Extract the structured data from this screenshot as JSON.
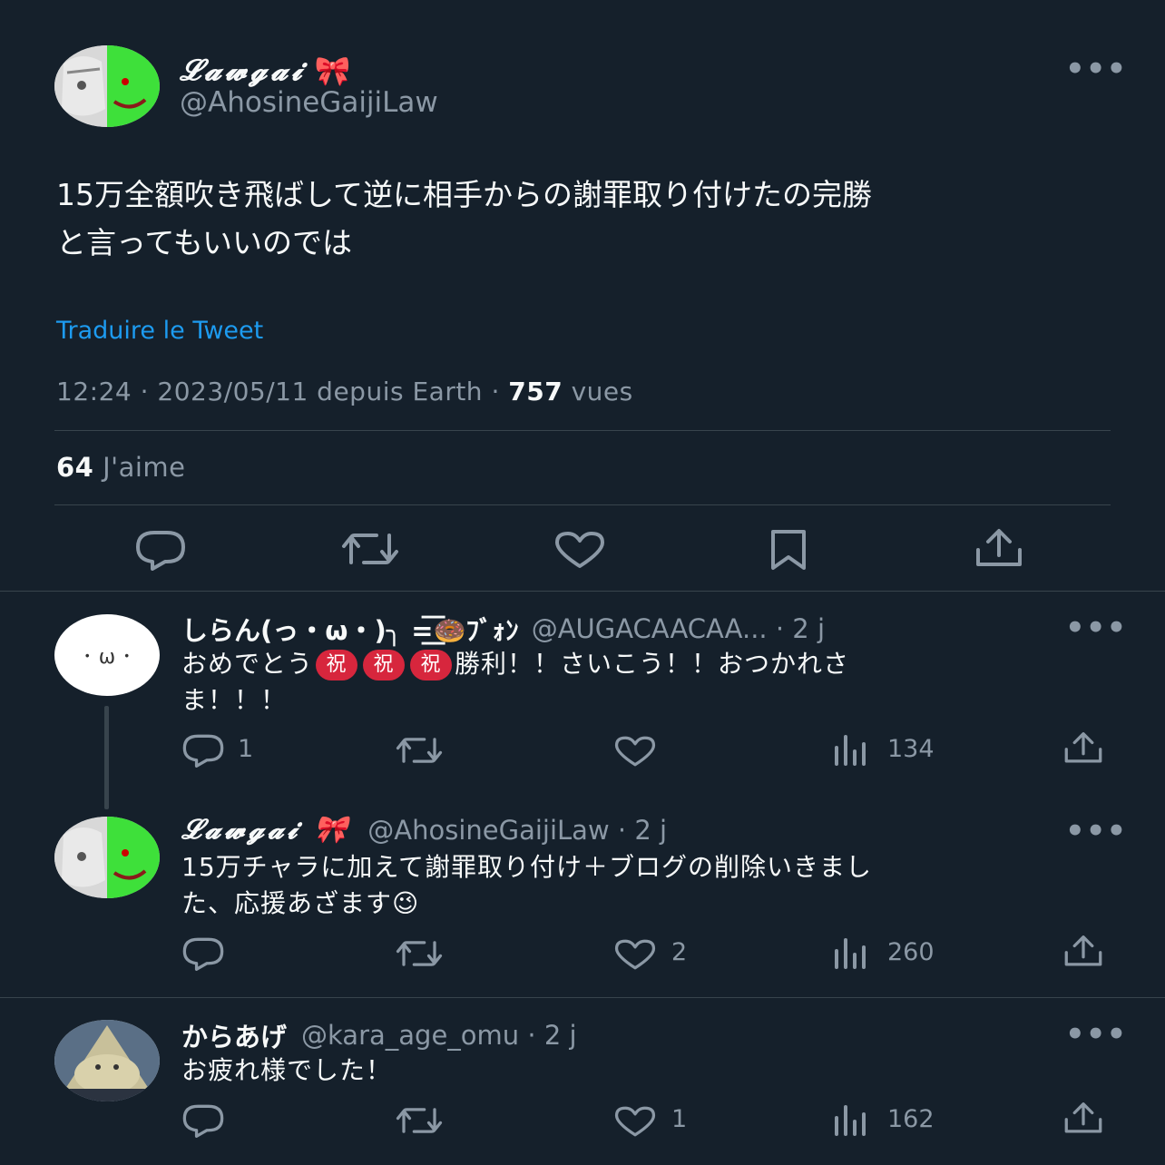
{
  "main_tweet": {
    "author_name": "𝓛𝓪𝔀𝓰𝓪𝓲",
    "author_emoji": "🎀",
    "handle": "@AhosineGaijiLaw",
    "more": "•••",
    "text_line1": "15万全額吹き飛ばして逆に相手からの謝罪取り付けたの完勝",
    "text_line2": "と言ってもいいのでは",
    "translate": "Traduire le Tweet",
    "meta_time": "12:24 · 2023/05/11 depuis Earth · ",
    "views": "757",
    "views_label": " vues",
    "likes": "64",
    "likes_label": " J'aime"
  },
  "replies": [
    {
      "name": "しらん(っ・ω・)╮ =͟͟͞͞🍩ﾌﾞｫﾝ",
      "handle": "@AUGACAACAA... · 2 j",
      "text_a": "おめでとう",
      "badges": [
        "祝",
        "祝",
        "祝"
      ],
      "text_b": "勝利！！さいこう！！おつかれさ",
      "text_c": "ま！！！",
      "replies": "1",
      "retweets": "",
      "likes": "",
      "views": "134"
    },
    {
      "name": "𝓛𝓪𝔀𝓰𝓪𝓲 🎀",
      "handle": "@AhosineGaijiLaw · 2 j",
      "text_a": "15万チャラに加えて謝罪取り付け＋ブログの削除いきまし",
      "text_b": "た、応援あざます😉",
      "replies": "",
      "retweets": "",
      "likes": "2",
      "views": "260"
    },
    {
      "name": "からあげ",
      "handle": "@kara_age_omu · 2 j",
      "text_a": "お疲れ様でした！",
      "replies": "",
      "retweets": "",
      "likes": "1",
      "views": "162"
    }
  ],
  "more": "•••",
  "avatar_face": "･ ω ･"
}
